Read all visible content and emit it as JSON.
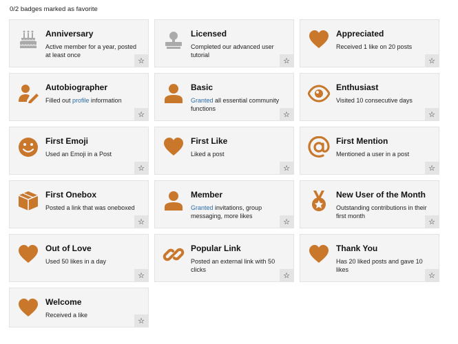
{
  "header": {
    "favorites_count": "0/2 badges marked as favorite"
  },
  "colors": {
    "accent": "#c9772b",
    "muted": "#aaaaaa",
    "link": "#2b6aa6"
  },
  "badges": [
    {
      "name": "Anniversary",
      "icon": "cake-icon",
      "desc": "Active member for a year, posted at least once",
      "granted": false
    },
    {
      "name": "Licensed",
      "icon": "certificate-icon",
      "desc": "Completed our advanced user tutorial",
      "granted": false
    },
    {
      "name": "Appreciated",
      "icon": "heart-icon",
      "desc": "Received 1 like on 20 posts",
      "granted": true
    },
    {
      "name": "Autobiographer",
      "icon": "user-edit-icon",
      "desc_link": "profile",
      "desc_pre": "Filled out ",
      "desc_post": " information",
      "granted": true
    },
    {
      "name": "Basic",
      "icon": "user-icon",
      "desc_link": "Granted",
      "desc_pre": "",
      "desc_post": " all essential community functions",
      "granted": true
    },
    {
      "name": "Enthusiast",
      "icon": "eye-icon",
      "desc": "Visited 10 consecutive days",
      "granted": true
    },
    {
      "name": "First Emoji",
      "icon": "smile-icon",
      "desc": "Used an Emoji in a Post",
      "granted": true
    },
    {
      "name": "First Like",
      "icon": "heart-icon",
      "desc": "Liked a post",
      "granted": true
    },
    {
      "name": "First Mention",
      "icon": "at-icon",
      "desc": "Mentioned a user in a post",
      "granted": true
    },
    {
      "name": "First Onebox",
      "icon": "cube-icon",
      "desc": "Posted a link that was oneboxed",
      "granted": true
    },
    {
      "name": "Member",
      "icon": "user-icon",
      "desc_link": "Granted",
      "desc_pre": "",
      "desc_post": " invitations, group messaging, more likes",
      "granted": true
    },
    {
      "name": "New User of the Month",
      "icon": "medal-icon",
      "desc": "Outstanding contributions in their first month",
      "granted": true
    },
    {
      "name": "Out of Love",
      "icon": "heart-icon",
      "desc": "Used 50 likes in a day",
      "granted": true
    },
    {
      "name": "Popular Link",
      "icon": "link-icon",
      "desc": "Posted an external link with 50 clicks",
      "granted": true
    },
    {
      "name": "Thank You",
      "icon": "heart-icon",
      "desc": "Has 20 liked posts and gave 10 likes",
      "granted": true
    },
    {
      "name": "Welcome",
      "icon": "heart-icon",
      "desc": "Received a like",
      "granted": true
    }
  ],
  "favorite_button": {
    "glyph": "☆"
  }
}
